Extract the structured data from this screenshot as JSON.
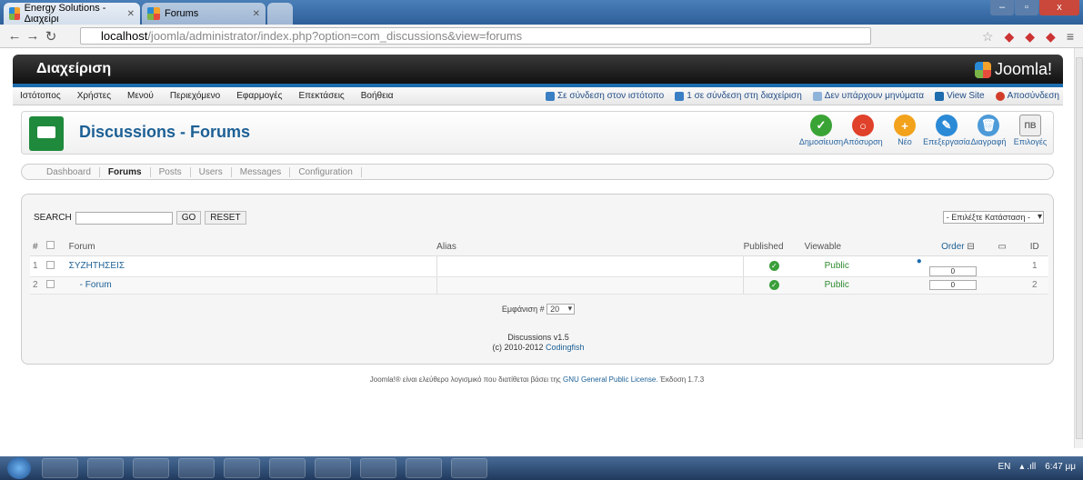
{
  "browser": {
    "tabs": [
      {
        "title": "Energy Solutions - Διαχείρι",
        "active": true
      },
      {
        "title": "Forums",
        "active": false
      }
    ],
    "url_host": "localhost",
    "url_path": "/joomla/administrator/index.php?option=com_discussions&view=forums",
    "window_controls": [
      "–",
      "▫",
      "x"
    ]
  },
  "header": {
    "title": "Διαχείριση",
    "brand": "Joomla!"
  },
  "menu": {
    "left": [
      "Ιστότοπος",
      "Χρήστες",
      "Μενού",
      "Περιεχόμενο",
      "Εφαρμογές",
      "Επεκτάσεις",
      "Βοήθεια"
    ],
    "right": [
      {
        "label": "Σε σύνδεση στον ιστότοπο",
        "icon": "users-icon",
        "color": "#3a7fc4"
      },
      {
        "label": "1 σε σύνδεση στη διαχείριση",
        "icon": "users-icon",
        "color": "#3a7fc4"
      },
      {
        "label": "Δεν υπάρχουν μηνύματα",
        "icon": "mail-icon",
        "color": "#8fb3d9"
      },
      {
        "label": "View Site",
        "icon": "monitor-icon",
        "color": "#1d6cad"
      },
      {
        "label": "Αποσύνδεση",
        "icon": "logout-icon",
        "color": "#d23d2a"
      }
    ]
  },
  "page_title": "Discussions - Forums",
  "toolbar": [
    {
      "label": "Δημοσίευση",
      "icon": "publish-icon",
      "color": "#3aa335",
      "glyph": "✓"
    },
    {
      "label": "Απόσυρση",
      "icon": "unpublish-icon",
      "color": "#e0412a",
      "glyph": "○"
    },
    {
      "label": "Νέο",
      "icon": "new-icon",
      "color": "#f2a21b",
      "glyph": "+"
    },
    {
      "label": "Επεξεργασία",
      "icon": "edit-icon",
      "color": "#2b8ad6",
      "glyph": "✎"
    },
    {
      "label": "Διαγραφή",
      "icon": "trash-icon",
      "color": "#4c9ad8",
      "glyph": "🗑"
    },
    {
      "label": "Επιλογές",
      "icon": "options-icon",
      "color": "#888888",
      "glyph": "ΠΒ"
    }
  ],
  "subnav": [
    "Dashboard",
    "Forums",
    "Posts",
    "Users",
    "Messages",
    "Configuration"
  ],
  "subnav_active": "Forums",
  "search": {
    "label": "SEARCH",
    "value": "",
    "go": "GO",
    "reset": "RESET"
  },
  "status_filter": "- Επιλέξτε Κατάσταση -",
  "table": {
    "headers": {
      "num": "#",
      "forum": "Forum",
      "alias": "Alias",
      "published": "Published",
      "viewable": "Viewable",
      "order": "Order",
      "id": "ID"
    },
    "rows": [
      {
        "num": "1",
        "forum": "ΣΥΖΗΤΗΣΕΙΣ",
        "alias": "",
        "viewable": "Public",
        "order": "0",
        "id": "1",
        "has_arrow": true,
        "alt": false
      },
      {
        "num": "2",
        "forum": "- Forum",
        "alias": "",
        "viewable": "Public",
        "order": "0",
        "id": "2",
        "has_arrow": false,
        "alt": true
      }
    ]
  },
  "pagination": {
    "label": "Εμφάνιση #",
    "value": "20"
  },
  "version": {
    "line1": "Discussions v1.5",
    "line2_prefix": "(c) 2010-2012",
    "line2_link": "Codingfish"
  },
  "footer": {
    "prefix": "Joomla!® είναι ελεύθερο λογισμικό που διατίθεται βάσει της",
    "link": "GNU General Public License.",
    "version": "Έκδοση 1.7.3"
  },
  "taskbar": {
    "lang": "EN",
    "time": "6:47 μμ"
  }
}
